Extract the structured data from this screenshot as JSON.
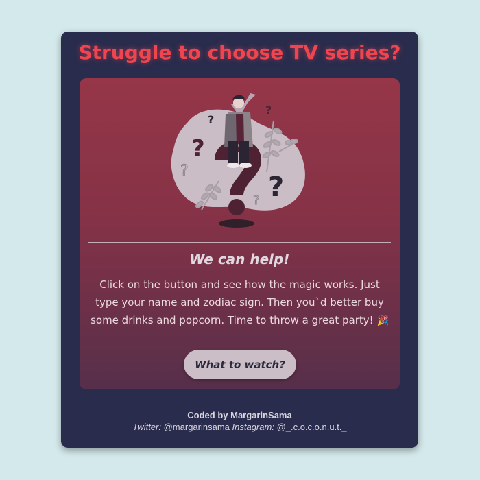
{
  "page": {
    "title": "Struggle to choose TV series?"
  },
  "hero": {
    "illustration_icon": "confused-person-question-marks-icon"
  },
  "intro": {
    "subtitle": "We can help!",
    "description": "Click on the button and see how the magic works. Just type your name and zodiac sign. Then you`d better buy some drinks and popcorn. Time to throw a great party!",
    "party_emoji": "🎉",
    "party_icon": "party-popper-icon"
  },
  "cta": {
    "label": "What to watch?"
  },
  "footer": {
    "credit": "Coded by MargarinSama",
    "twitter_label": "Twitter:",
    "twitter_handle": "@margarinsama",
    "instagram_label": "Instagram:",
    "instagram_handle": "@_.c.o.c.o.n.u.t._"
  },
  "colors": {
    "page_background": "#d4e9ec",
    "card_background": "#292c4d",
    "title": "#f0454f",
    "panel_top": "#963648",
    "panel_bottom": "#562f4a",
    "button": "#ccbec6"
  }
}
